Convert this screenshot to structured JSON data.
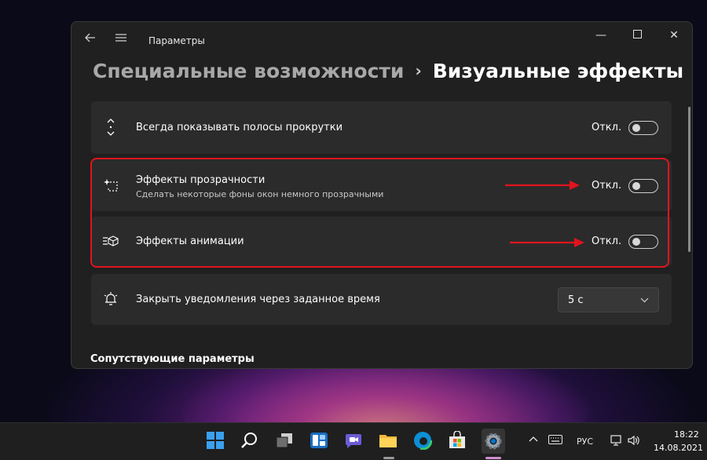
{
  "window": {
    "app_title": "Параметры",
    "controls": {
      "minimize": "—",
      "maximize": "☐",
      "close": "✕"
    }
  },
  "breadcrumb": {
    "parent": "Специальные возможности",
    "separator": "›",
    "current": "Визуальные эффекты"
  },
  "settings": [
    {
      "icon": "scroll-arrows-icon",
      "title": "Всегда показывать полосы прокрутки",
      "subtitle": "",
      "state_label": "Откл.",
      "enabled": false
    },
    {
      "icon": "transparency-sparkle-icon",
      "title": "Эффекты прозрачности",
      "subtitle": "Сделать некоторые фоны окон немного прозрачными",
      "state_label": "Откл.",
      "enabled": false
    },
    {
      "icon": "animation-effects-icon",
      "title": "Эффекты анимации",
      "subtitle": "",
      "state_label": "Откл.",
      "enabled": false
    },
    {
      "icon": "notification-timer-icon",
      "title": "Закрыть уведомления через заданное время",
      "subtitle": "",
      "dropdown_value": "5 с"
    }
  ],
  "related_heading": "Сопутствующие параметры",
  "annotation": {
    "highlight_color": "#e0141e"
  },
  "taskbar": {
    "apps": [
      "start-icon",
      "search-icon",
      "task-view-icon",
      "widgets-icon",
      "teams-chat-icon",
      "file-explorer-icon",
      "edge-icon",
      "store-icon",
      "settings-icon"
    ],
    "tray": {
      "language": "РУС",
      "time": "18:22",
      "date": "14.08.2021"
    }
  },
  "colors": {
    "window_bg": "#202020",
    "card_bg": "#2b2b2b",
    "accent_taskbar_blue": "#0078d4"
  }
}
